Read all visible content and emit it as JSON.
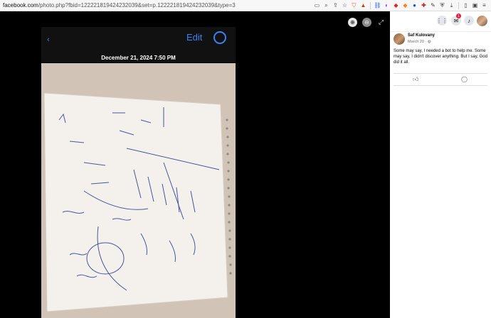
{
  "browser": {
    "url_host": "facebook.com",
    "url_rest": "/photo.php?fbid=122221819424232039&set=p.122221819424232039&type=3"
  },
  "phone_photo": {
    "date_label": "December 21, 2024  7:50 PM",
    "edit_label": "Edit"
  },
  "post": {
    "author": "Saf Kulovany",
    "date": "March 20 · ",
    "text": "Some may say, I needed a bot to help me. Some may say, I didn't discover anything. But I say, God did it all."
  },
  "panel": {
    "notification_count": "1"
  }
}
